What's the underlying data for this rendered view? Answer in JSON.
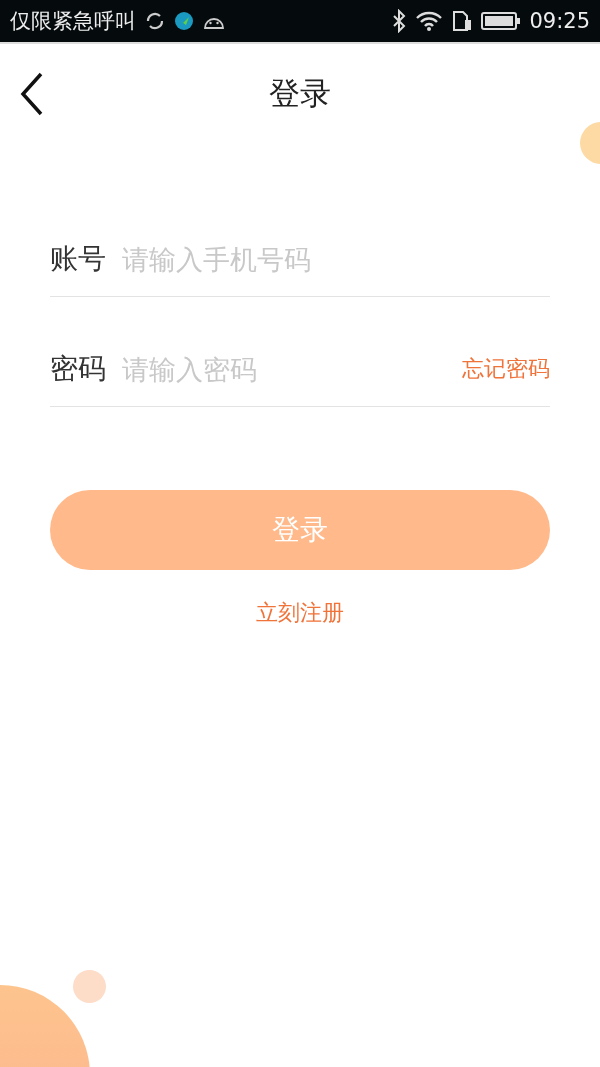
{
  "status_bar": {
    "notice": "仅限紧急呼叫",
    "time": "09:25"
  },
  "header": {
    "title": "登录"
  },
  "form": {
    "fields": [
      {
        "label": "账号",
        "placeholder": "请输入手机号码"
      },
      {
        "label": "密码",
        "placeholder": "请输入密码",
        "link": "忘记密码"
      }
    ],
    "submit": {
      "label": "登录",
      "disabled": true
    },
    "register": "立刻注册"
  }
}
